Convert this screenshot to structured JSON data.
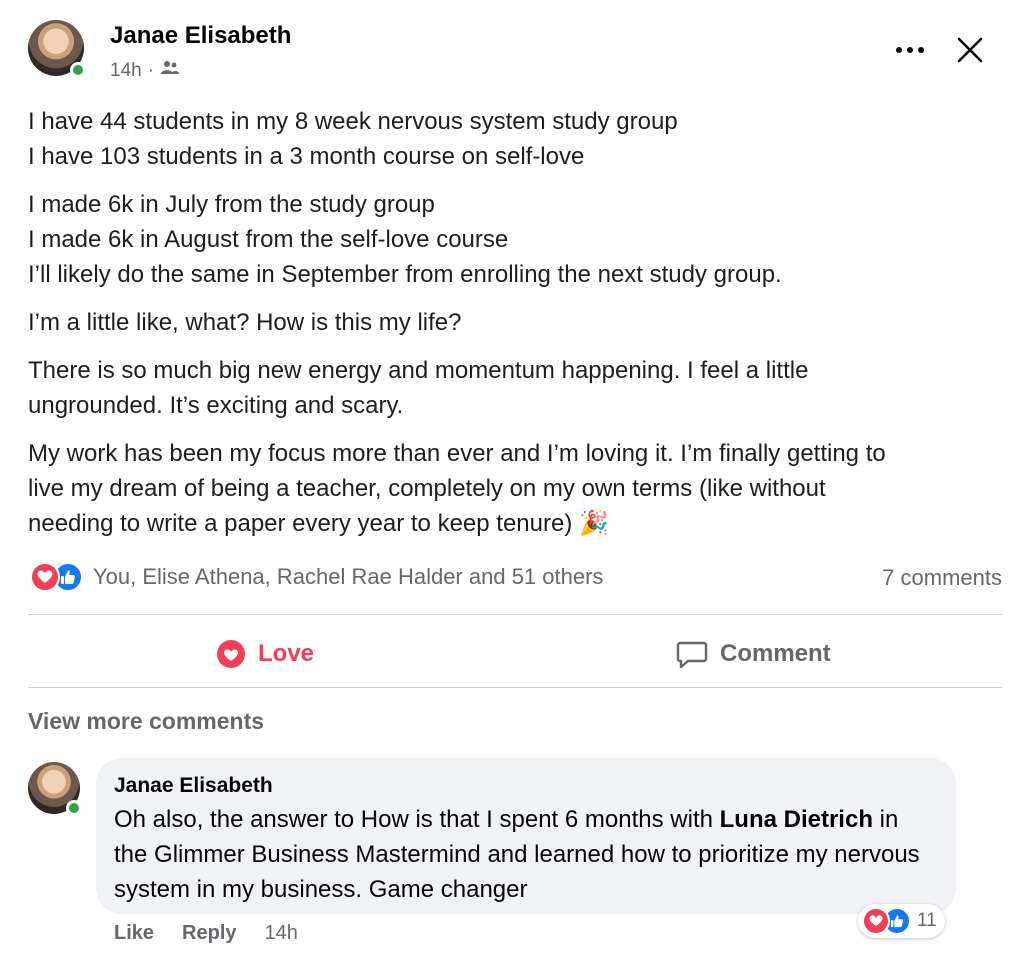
{
  "post": {
    "author": "Janae Elisabeth",
    "time": "14h",
    "time_separator": "·",
    "audience_icon": "friends-icon",
    "paragraphs": [
      [
        "I have 44 students in my 8 week nervous system study group",
        "I have 103 students in a 3 month course on self-love"
      ],
      [
        "I made 6k in July from the study group",
        "I made 6k in August from the self-love course",
        "I’ll likely do the same in September from enrolling the next study group."
      ],
      [
        "I’m a little like, what? How is this my life?"
      ],
      [
        "There is so much big new energy and momentum happening. I feel a little",
        "ungrounded. It’s exciting and scary."
      ],
      [
        "My work has been my focus more than ever and I’m loving it. I’m finally getting to",
        "live my dream of being a teacher, completely on my own terms (like without",
        "needing to write a paper every year to keep tenure) 🎉"
      ]
    ],
    "reaction_names": "You, Elise Athena, Rachel Rae Halder and 51 others",
    "comments_count": "7 comments",
    "actions": {
      "love_label": "Love",
      "comment_label": "Comment"
    },
    "view_more": "View more comments"
  },
  "comment": {
    "author": "Janae Elisabeth",
    "text_before": "Oh also, the answer to How is that I spent 6 months with ",
    "text_bold": "Luna Dietrich",
    "text_after": " in the Glimmer Business Mastermind and learned how to prioritize my nervous system in my business. Game changer",
    "reaction_count": "11",
    "like_label": "Like",
    "reply_label": "Reply",
    "time": "14h"
  },
  "colors": {
    "love": "#f33e58",
    "like": "#1877f2",
    "online": "#31a24c",
    "secondary_text": "#65676b",
    "bubble": "#f0f2f5"
  }
}
